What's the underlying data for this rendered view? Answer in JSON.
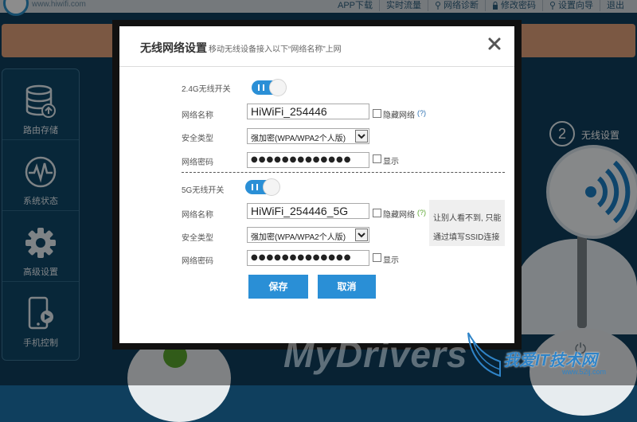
{
  "topbar": {
    "site": "www.hiwifi.com",
    "nav": [
      "APP下载",
      "实时流量",
      "网络诊断",
      "修改密码",
      "设置向导",
      "退出"
    ]
  },
  "sidebar": {
    "items": [
      {
        "label": "路由存储",
        "icon": "database-icon"
      },
      {
        "label": "系统状态",
        "icon": "pulse-icon"
      },
      {
        "label": "高级设置",
        "icon": "gear-icon"
      },
      {
        "label": "手机控制",
        "icon": "phone-icon"
      }
    ]
  },
  "right_panel": {
    "step_number": "2",
    "label": "无线设置"
  },
  "watermark": {
    "text": "MyDrivers",
    "cn": "我爱IT技术网",
    "url": "www.52ij.com"
  },
  "dialog": {
    "title": "无线网络设置",
    "subtitle": "移动无线设备接入以下“网络名称”上网",
    "band24": {
      "switch_label": "2.4G无线开关",
      "enabled": true,
      "ssid_label": "网络名称",
      "ssid_value": "HiWiFi_254446",
      "hide_label": "隐藏网络",
      "help": "(?)",
      "security_label": "安全类型",
      "security_value": "强加密(WPA/WPA2个人版)",
      "password_label": "网络密码",
      "password_value": "●●●●●●●●●●●●●",
      "show_label": "显示"
    },
    "band5": {
      "switch_label": "5G无线开关",
      "enabled": true,
      "ssid_label": "网络名称",
      "ssid_value": "HiWiFi_254446_5G",
      "hide_label": "隐藏网络",
      "help": "(?)",
      "security_label": "安全类型",
      "security_value": "强加密(WPA/WPA2个人版)",
      "password_label": "网络密码",
      "password_value": "●●●●●●●●●●●●●",
      "show_label": "显示"
    },
    "tooltip": {
      "line1": "让别人看不到, 只能",
      "line2": "通过填写SSID连接"
    },
    "save_label": "保存",
    "cancel_label": "取消"
  },
  "colors": {
    "accent": "#2a8fd6",
    "help_blue": "#2a6fb0",
    "help_green": "#5aa62f",
    "background": "#0f3f5e"
  }
}
